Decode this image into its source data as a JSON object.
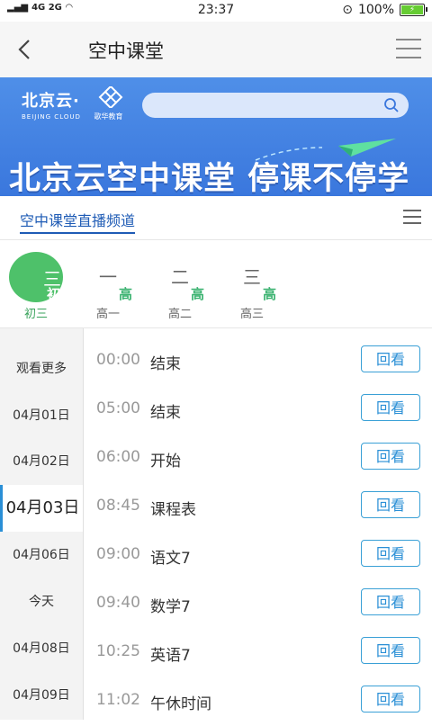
{
  "status_bar": {
    "signal_text": "4G 2G",
    "time": "23:37",
    "battery": "100%"
  },
  "header": {
    "title": "空中课堂"
  },
  "banner": {
    "logo_cn": "北京云·",
    "logo_en": "BEIJING CLOUD",
    "partner_name": "歌华教育",
    "headline": "北京云空中课堂 停课不停学"
  },
  "channel": {
    "title": "空中课堂直播频道"
  },
  "grades": [
    {
      "glyph": "三",
      "sub": "初",
      "label": "初三",
      "active": true
    },
    {
      "glyph": "一",
      "sub": "高",
      "label": "高一",
      "active": false
    },
    {
      "glyph": "二",
      "sub": "高",
      "label": "高二",
      "active": false
    },
    {
      "glyph": "三",
      "sub": "高",
      "label": "高三",
      "active": false
    }
  ],
  "dates": [
    {
      "label": "观看更多"
    },
    {
      "label": "04月01日"
    },
    {
      "label": "04月02日"
    },
    {
      "label": "04月03日",
      "active": true
    },
    {
      "label": "04月06日"
    },
    {
      "label": "今天"
    },
    {
      "label": "04月08日"
    },
    {
      "label": "04月09日"
    }
  ],
  "schedule": [
    {
      "time": "00:00",
      "title": "结束",
      "action": "回看"
    },
    {
      "time": "05:00",
      "title": "结束",
      "action": "回看"
    },
    {
      "time": "06:00",
      "title": "开始",
      "action": "回看"
    },
    {
      "time": "08:45",
      "title": "课程表",
      "action": "回看"
    },
    {
      "time": "09:00",
      "title": "语文7",
      "action": "回看"
    },
    {
      "time": "09:40",
      "title": "数学7",
      "action": "回看"
    },
    {
      "time": "10:25",
      "title": "英语7",
      "action": "回看"
    },
    {
      "time": "11:02",
      "title": "午休时间",
      "action": "回看"
    }
  ],
  "colors": {
    "accent": "#2a8fd6",
    "active_grade": "#4ec16a",
    "banner": "#3a77dd"
  }
}
